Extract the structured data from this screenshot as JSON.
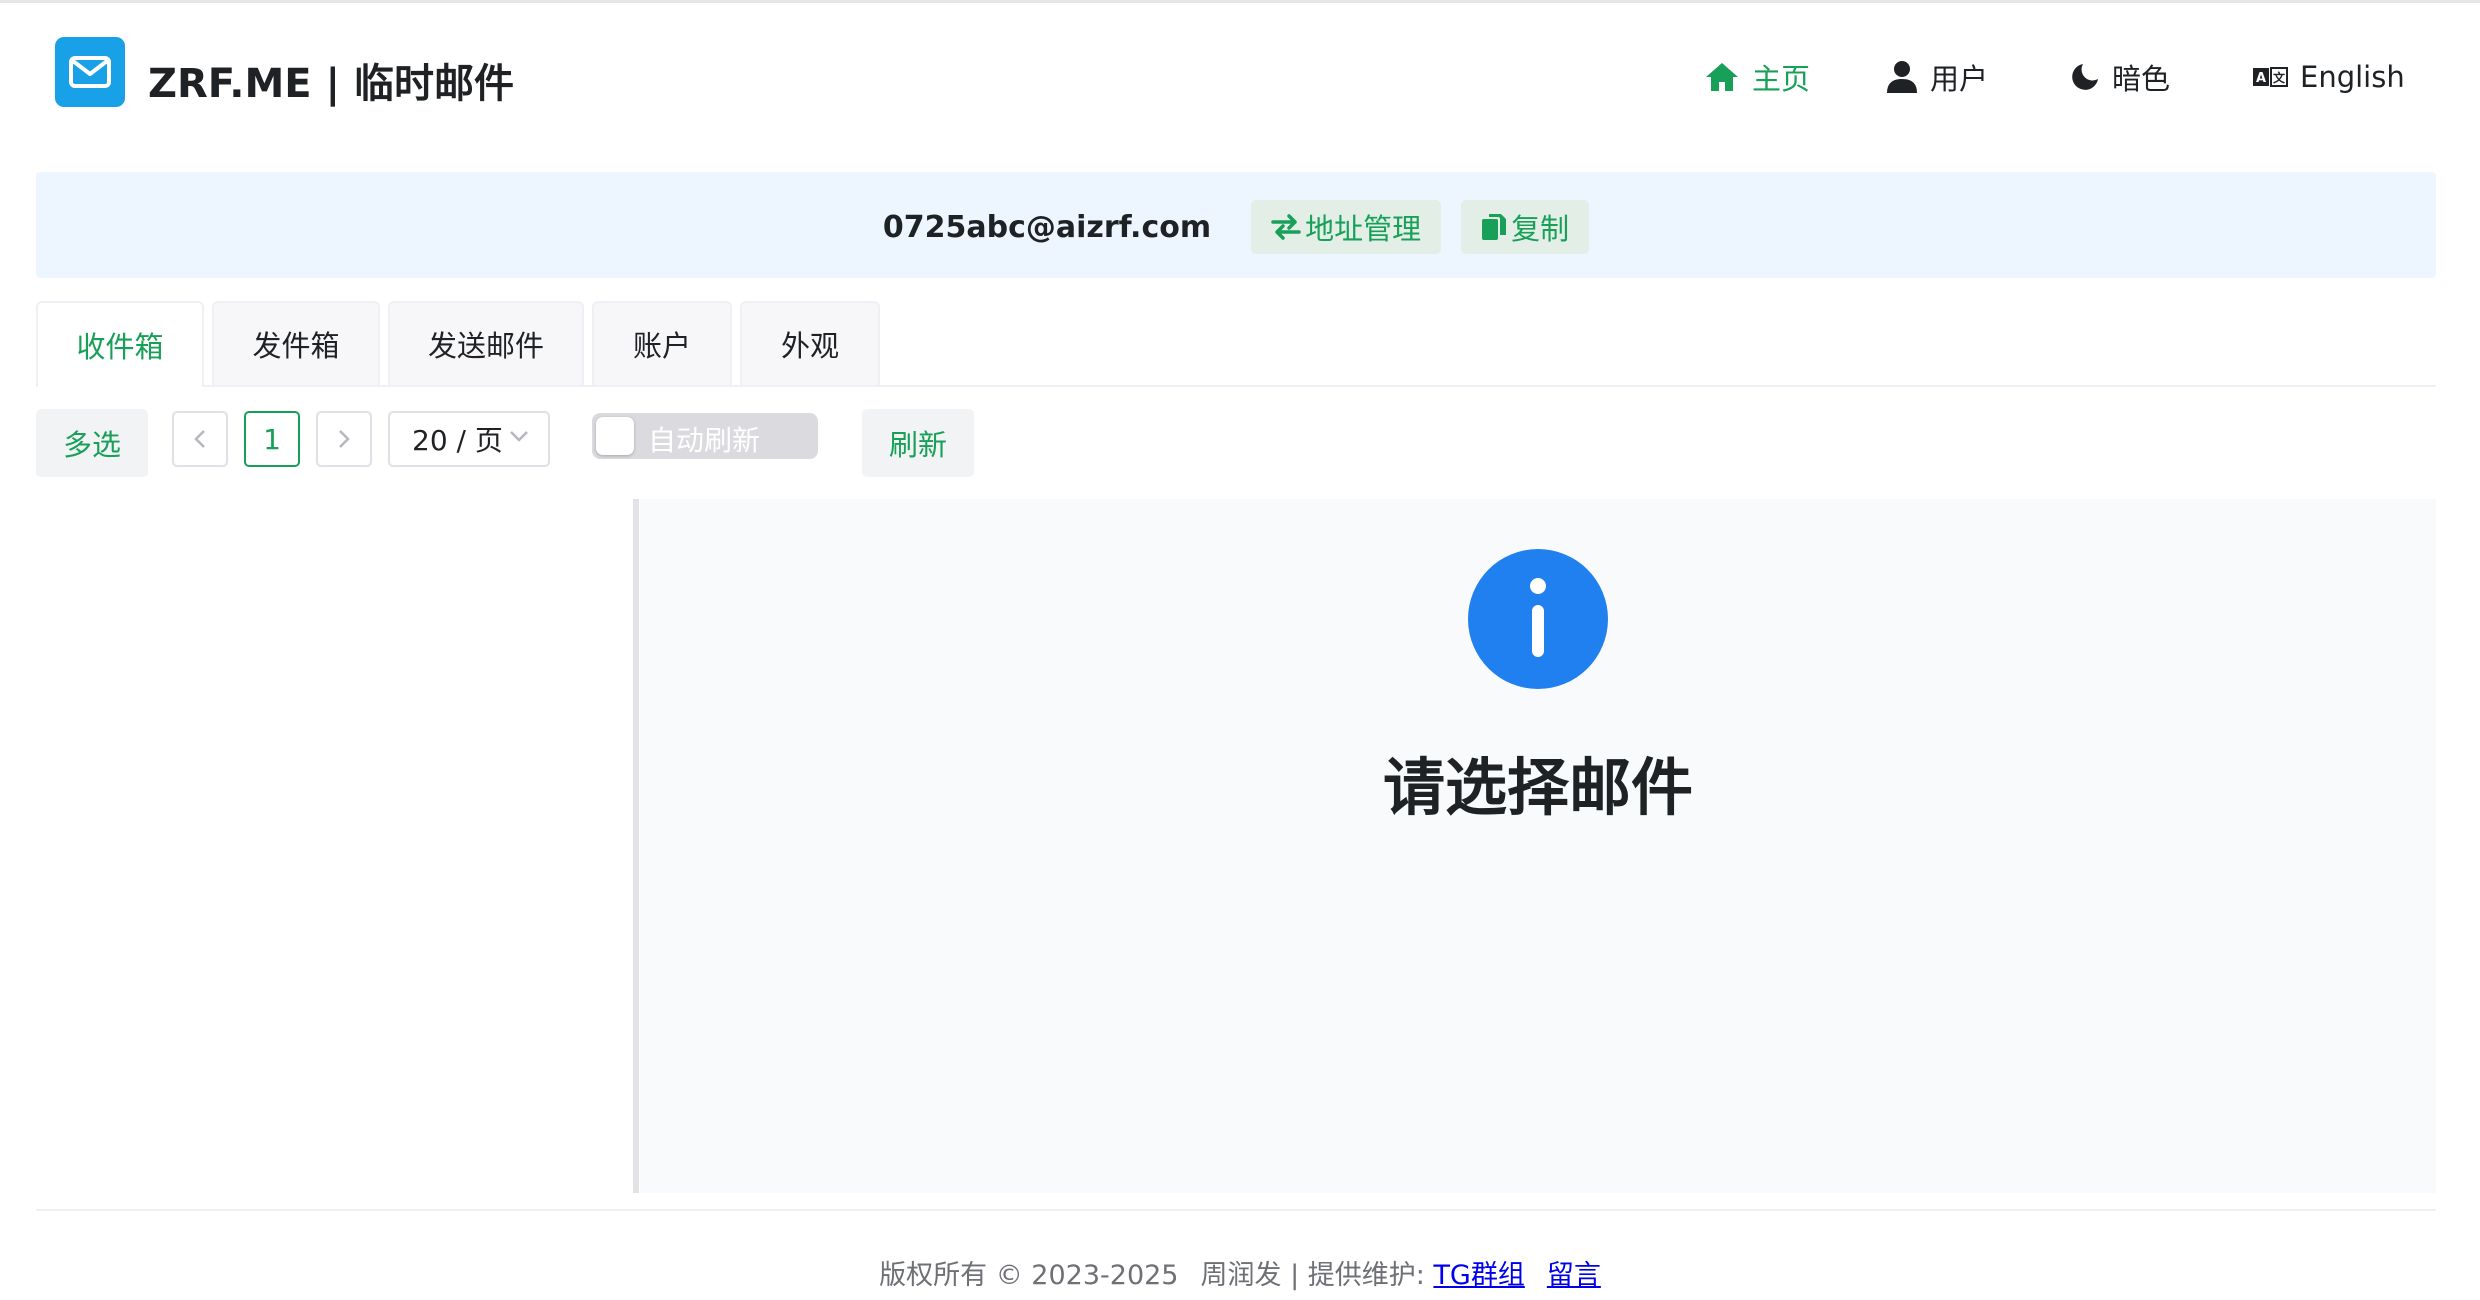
{
  "header": {
    "logo_icon": "envelope-icon",
    "title": "ZRF.ME | 临时邮件",
    "nav": [
      {
        "label": "主页",
        "icon": "home-icon",
        "active": true
      },
      {
        "label": "用户",
        "icon": "user-icon",
        "active": false
      },
      {
        "label": "暗色",
        "icon": "moon-icon",
        "active": false
      },
      {
        "label": "English",
        "icon": "translate-icon",
        "active": false
      }
    ]
  },
  "address_bar": {
    "address": "0725abc@aizrf.com",
    "manage_label": "地址管理",
    "copy_label": "复制"
  },
  "tabs": [
    {
      "label": "收件箱",
      "active": true
    },
    {
      "label": "发件箱",
      "active": false
    },
    {
      "label": "发送邮件",
      "active": false
    },
    {
      "label": "账户",
      "active": false
    },
    {
      "label": "外观",
      "active": false
    }
  ],
  "toolbar": {
    "multi_select_label": "多选",
    "current_page": "1",
    "page_size": "20 / 页",
    "auto_refresh_label": "自动刷新",
    "auto_refresh_on": false,
    "refresh_label": "刷新"
  },
  "mail_view": {
    "empty_icon": "info-icon",
    "empty_text": "请选择邮件"
  },
  "footer": {
    "copyright": "版权所有 © 2023-2025",
    "maintainer": "周润发 | 提供维护:",
    "tg_link": "TG群组",
    "message_link": "留言"
  },
  "colors": {
    "accent": "#18a058",
    "logo_bg": "#19a1e8",
    "info_blue": "#2080f0",
    "address_bg": "#edf5fe"
  }
}
